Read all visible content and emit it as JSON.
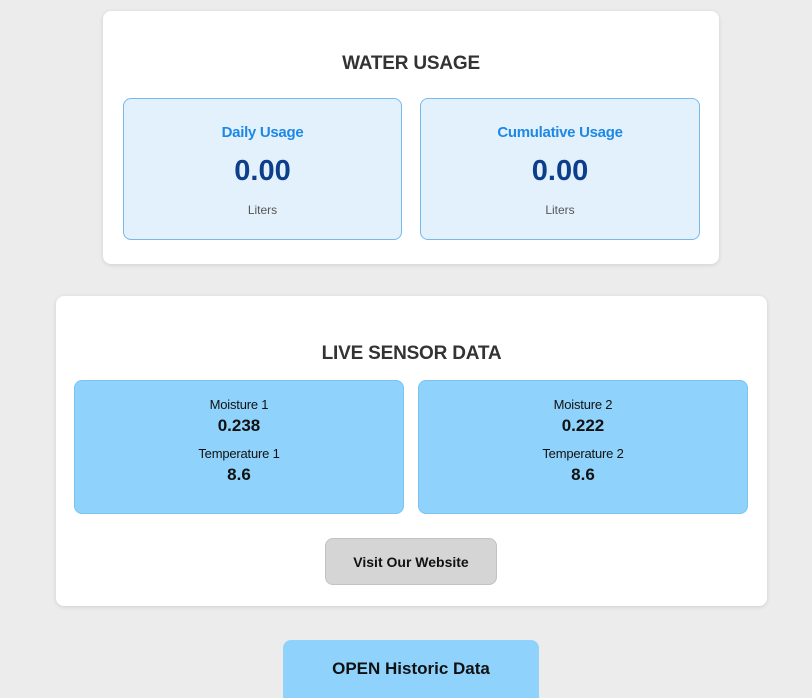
{
  "water_usage": {
    "title": "WATER USAGE",
    "daily": {
      "label": "Daily Usage",
      "value": "0.00",
      "unit": "Liters"
    },
    "cumulative": {
      "label": "Cumulative Usage",
      "value": "0.00",
      "unit": "Liters"
    }
  },
  "live_sensor": {
    "title": "LIVE SENSOR DATA",
    "sensors": [
      {
        "moisture_label": "Moisture 1",
        "moisture_value": "0.238",
        "temp_label": "Temperature 1",
        "temp_value": "8.6"
      },
      {
        "moisture_label": "Moisture 2",
        "moisture_value": "0.222",
        "temp_label": "Temperature 2",
        "temp_value": "8.6"
      }
    ],
    "visit_button": "Visit Our Website"
  },
  "historic_button": "OPEN Historic Data",
  "colors": {
    "page_background": "#ececec",
    "usage_box": "#e3f1fc",
    "usage_label": "#1e88e5",
    "usage_value": "#0d3e8c",
    "sensor_box": "#8fd3fd",
    "visit_button": "#d5d5d5"
  }
}
